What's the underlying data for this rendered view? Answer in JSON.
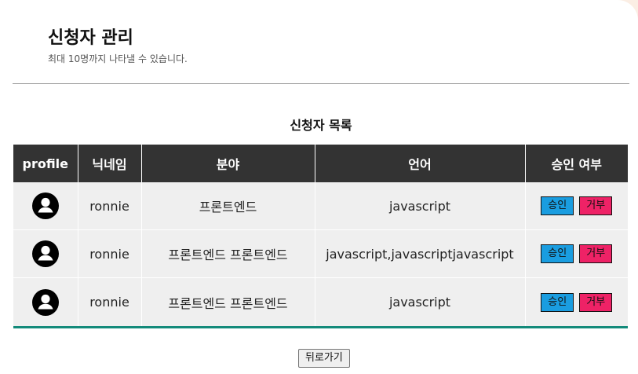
{
  "header": {
    "title": "신청자 관리",
    "subtitle": "최대 10명까지 나타낼 수 있습니다."
  },
  "list": {
    "title": "신청자 목록",
    "columns": [
      "profile",
      "닉네임",
      "분야",
      "언어",
      "승인 여부"
    ],
    "rows": [
      {
        "nickname": "ronnie",
        "field": "프론트엔드",
        "language": "javascript",
        "approve_label": "승인",
        "reject_label": "거부"
      },
      {
        "nickname": "ronnie",
        "field": "프론트엔드 프론트엔드",
        "language": "javascript,javascriptjavascript",
        "approve_label": "승인",
        "reject_label": "거부"
      },
      {
        "nickname": "ronnie",
        "field": "프론트엔드 프론트엔드",
        "language": "javascript",
        "approve_label": "승인",
        "reject_label": "거부"
      }
    ]
  },
  "footer": {
    "back_label": "뒤로가기"
  },
  "icons": {
    "profile": "account-circle-icon"
  },
  "colors": {
    "header_bg": "#333333",
    "row_bg": "#efefef",
    "table_bottom_border": "#138a7a",
    "approve_button": "#1a9de0",
    "reject_button": "#ee2266",
    "page_bg": "#fbeee4"
  }
}
